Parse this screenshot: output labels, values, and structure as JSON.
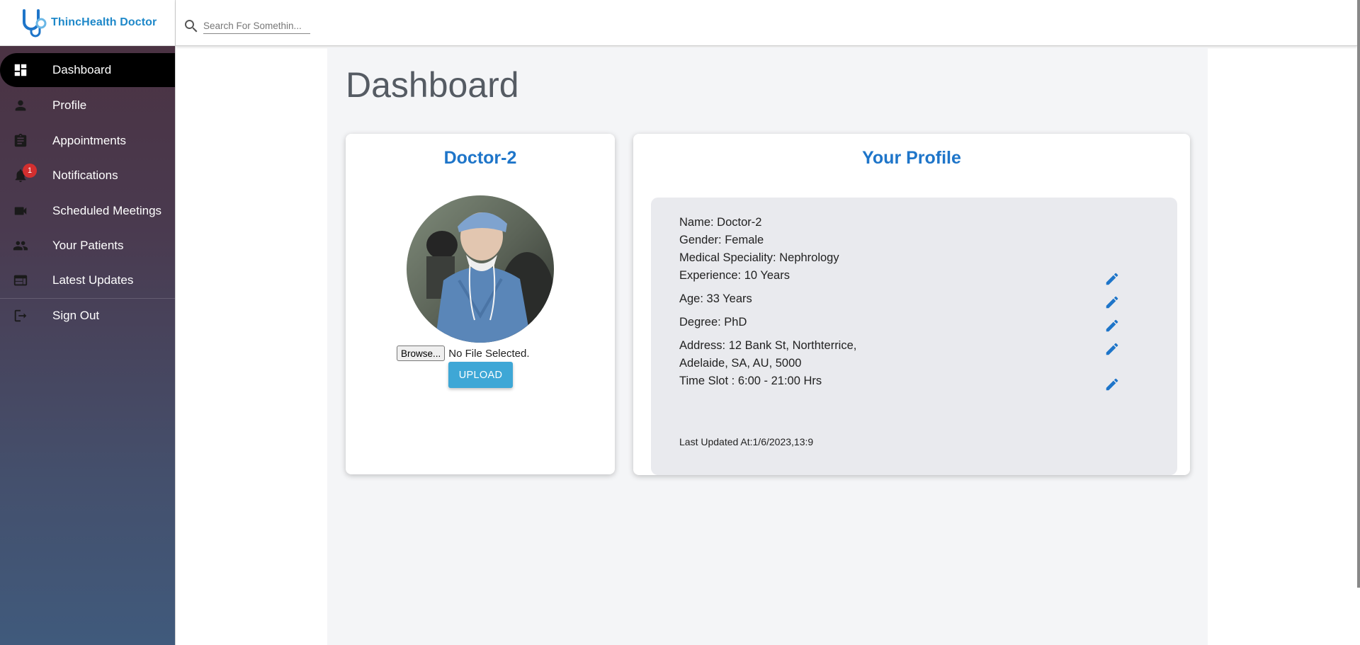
{
  "app": {
    "name": "ThincHealth Doctor"
  },
  "search": {
    "placeholder": "Search For Somethin..."
  },
  "sidebar": {
    "items": [
      {
        "label": "Dashboard",
        "icon": "dashboard-icon",
        "active": true
      },
      {
        "label": "Profile",
        "icon": "person-icon"
      },
      {
        "label": "Appointments",
        "icon": "clipboard-icon"
      },
      {
        "label": "Notifications",
        "icon": "bell-icon",
        "badge": "1"
      },
      {
        "label": "Scheduled Meetings",
        "icon": "videocam-icon"
      },
      {
        "label": "Your Patients",
        "icon": "people-icon"
      },
      {
        "label": "Latest Updates",
        "icon": "web-icon"
      },
      {
        "label": "Sign Out",
        "icon": "logout-icon"
      }
    ]
  },
  "page": {
    "title": "Dashboard"
  },
  "doctor_card": {
    "name": "Doctor-2",
    "browse_label": "Browse...",
    "file_status": "No File Selected.",
    "upload_label": "UPLOAD"
  },
  "profile_card": {
    "title": "Your Profile",
    "name": "Name: Doctor-2",
    "gender": "Gender: Female",
    "speciality": "Medical Speciality: Nephrology",
    "experience": "Experience: 10 Years",
    "age": "Age: 33 Years",
    "degree": "Degree: PhD",
    "address_line1": "Address: 12 Bank St, Northterrice,",
    "address_line2": "Adelaide, SA, AU, 5000",
    "time_slot": "Time Slot : 6:00 - 21:00 Hrs",
    "last_updated": "Last Updated At:1/6/2023,13:9"
  },
  "colors": {
    "accent": "#1e75c9",
    "upload_button": "#3ea7d6",
    "badge": "#d32f2f",
    "logo": "#1e88c9"
  }
}
